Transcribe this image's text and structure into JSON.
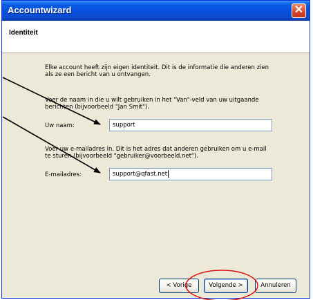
{
  "window": {
    "title": "Accountwizard",
    "close_glyph": "✕"
  },
  "page": {
    "heading": "Identiteit",
    "intro_line1": "Elke account heeft zijn eigen identiteit. Dit is de informatie die anderen zien",
    "intro_line2": "als ze een bericht van u ontvangen.",
    "name_help_line1": "Voer de naam in die u wilt gebruiken in het \"Van\"-veld van uw uitgaande",
    "name_help_line2": "berichten (bijvoorbeeld \"Jan Smit\").",
    "name_label": "Uw naam:",
    "name_value": "support",
    "email_help_line1": "Voer uw e-mailadres in. Dit is het adres dat anderen gebruiken om u e-mail",
    "email_help_line2": "te sturen (bijvoorbeeld \"gebruiker@voorbeeld.net\").",
    "email_label": "E-mailadres:",
    "email_value": "support@qfast.net"
  },
  "buttons": {
    "back": "< Vorige",
    "next": "Volgende >",
    "cancel": "Annuleren"
  },
  "annotation_color": "#e01010",
  "arrow_color": "#000000"
}
